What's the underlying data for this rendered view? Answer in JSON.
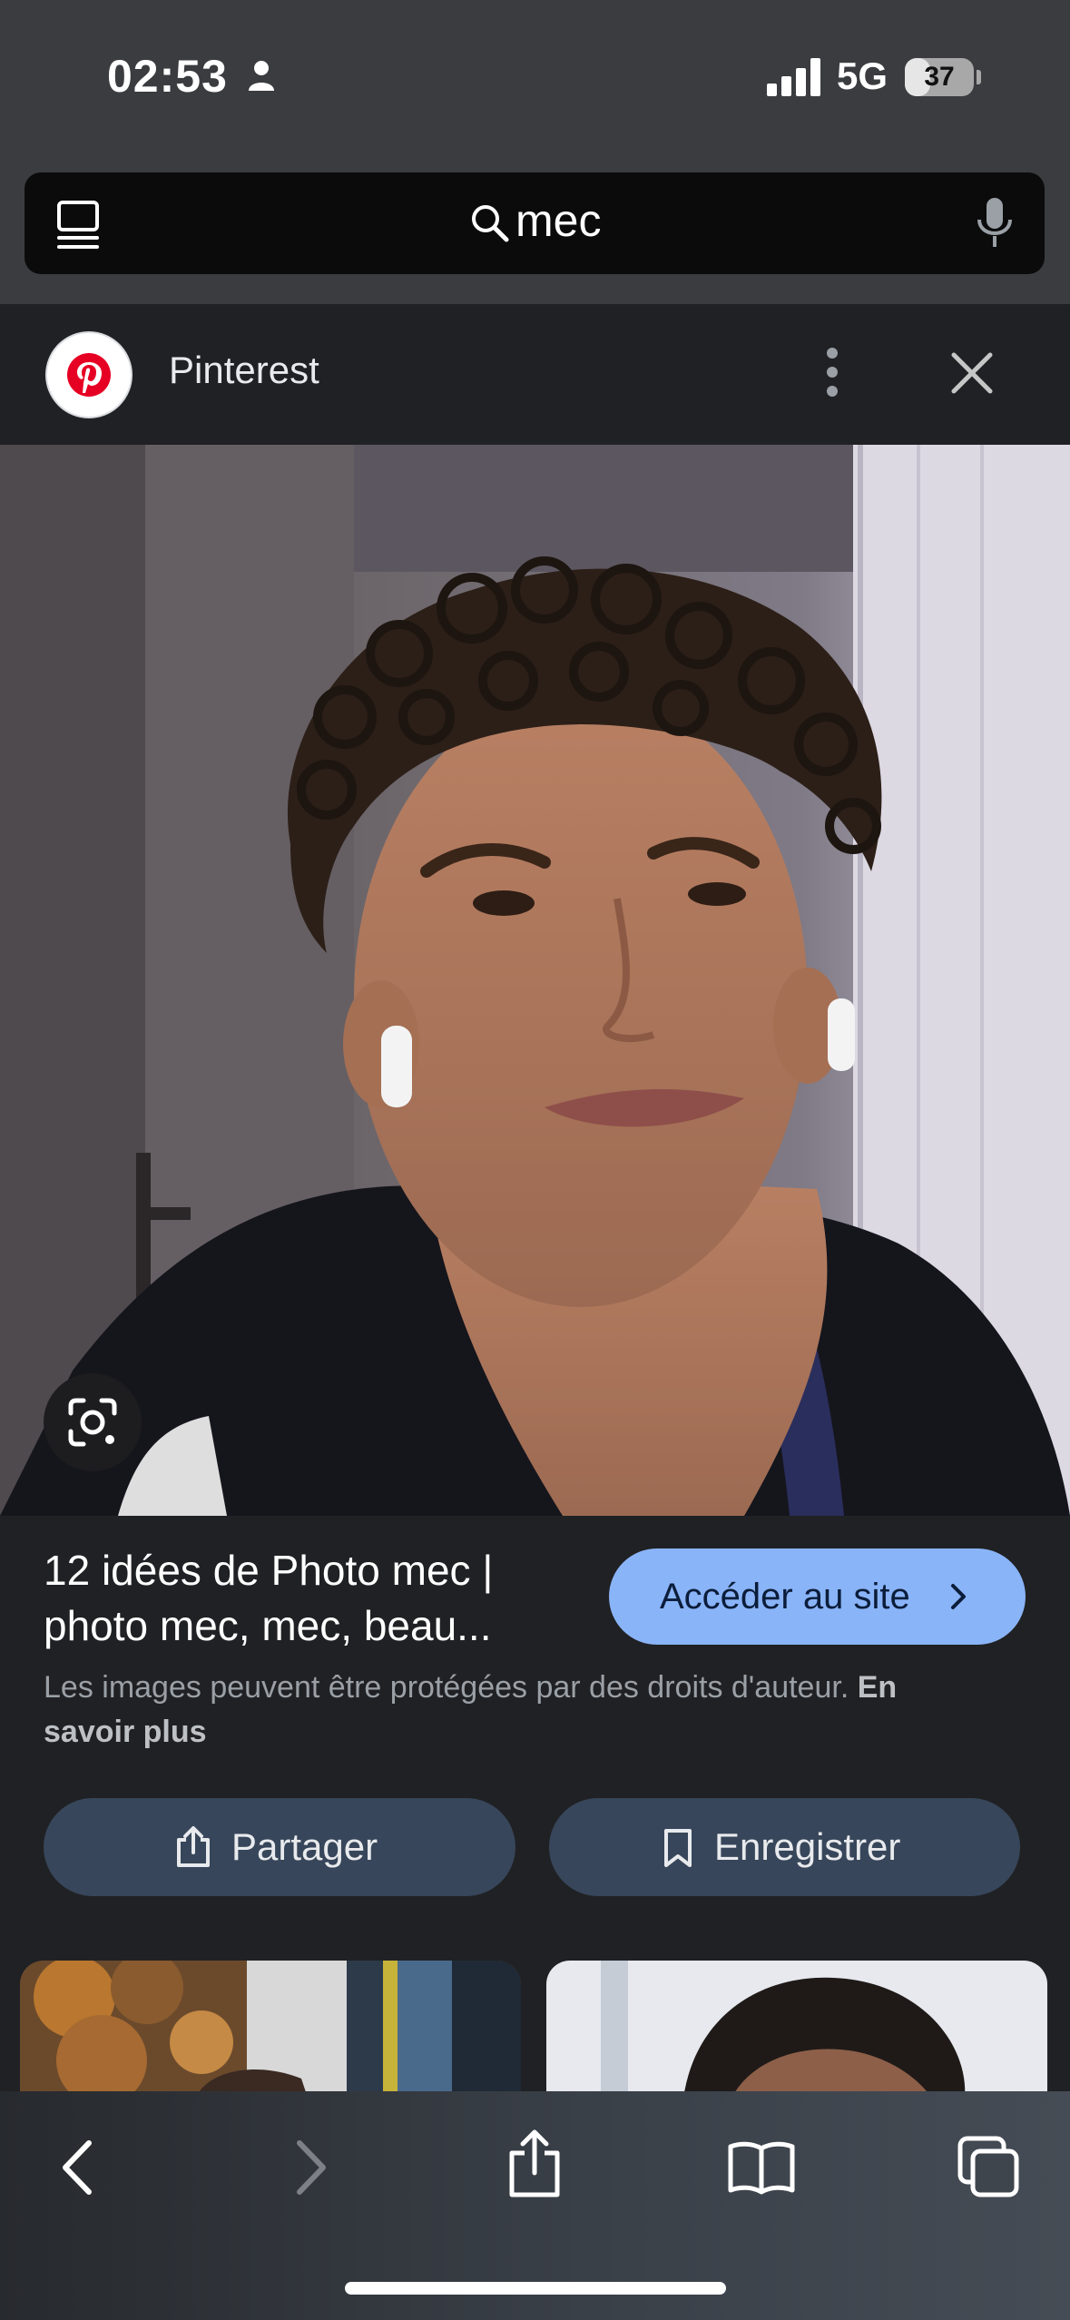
{
  "status_bar": {
    "time": "02:53",
    "network": "5G",
    "battery": "37",
    "battery_fraction": 0.37
  },
  "search": {
    "query": "mec"
  },
  "panel": {
    "source_name": "Pinterest",
    "result_title": "12 idées de Photo mec | photo mec, mec, beau...",
    "visit_button": "Accéder au site",
    "copyright_notice": "Les images peuvent être protégées par des droits d'auteur.",
    "learn_more": "En savoir plus",
    "share_button": "Partager",
    "save_button": "Enregistrer"
  },
  "icons": {
    "status": [
      "person-icon",
      "signal-bars-icon"
    ],
    "topbar": [
      "tabs-overview-icon",
      "search-icon",
      "microphone-icon"
    ],
    "panel": [
      "pinterest-logo",
      "more-vertical-icon",
      "close-icon",
      "google-lens-icon",
      "chevron-right-icon",
      "share-icon",
      "bookmark-icon"
    ],
    "toolbar": [
      "back-icon",
      "forward-icon",
      "share-icon",
      "bookmarks-icon",
      "tabs-icon"
    ]
  },
  "colors": {
    "background": "#202124",
    "chrome": "#3b3c3f",
    "accent_button": "#8ab4f8",
    "secondary_button": "#37465a",
    "pinterest_red": "#e60023"
  }
}
